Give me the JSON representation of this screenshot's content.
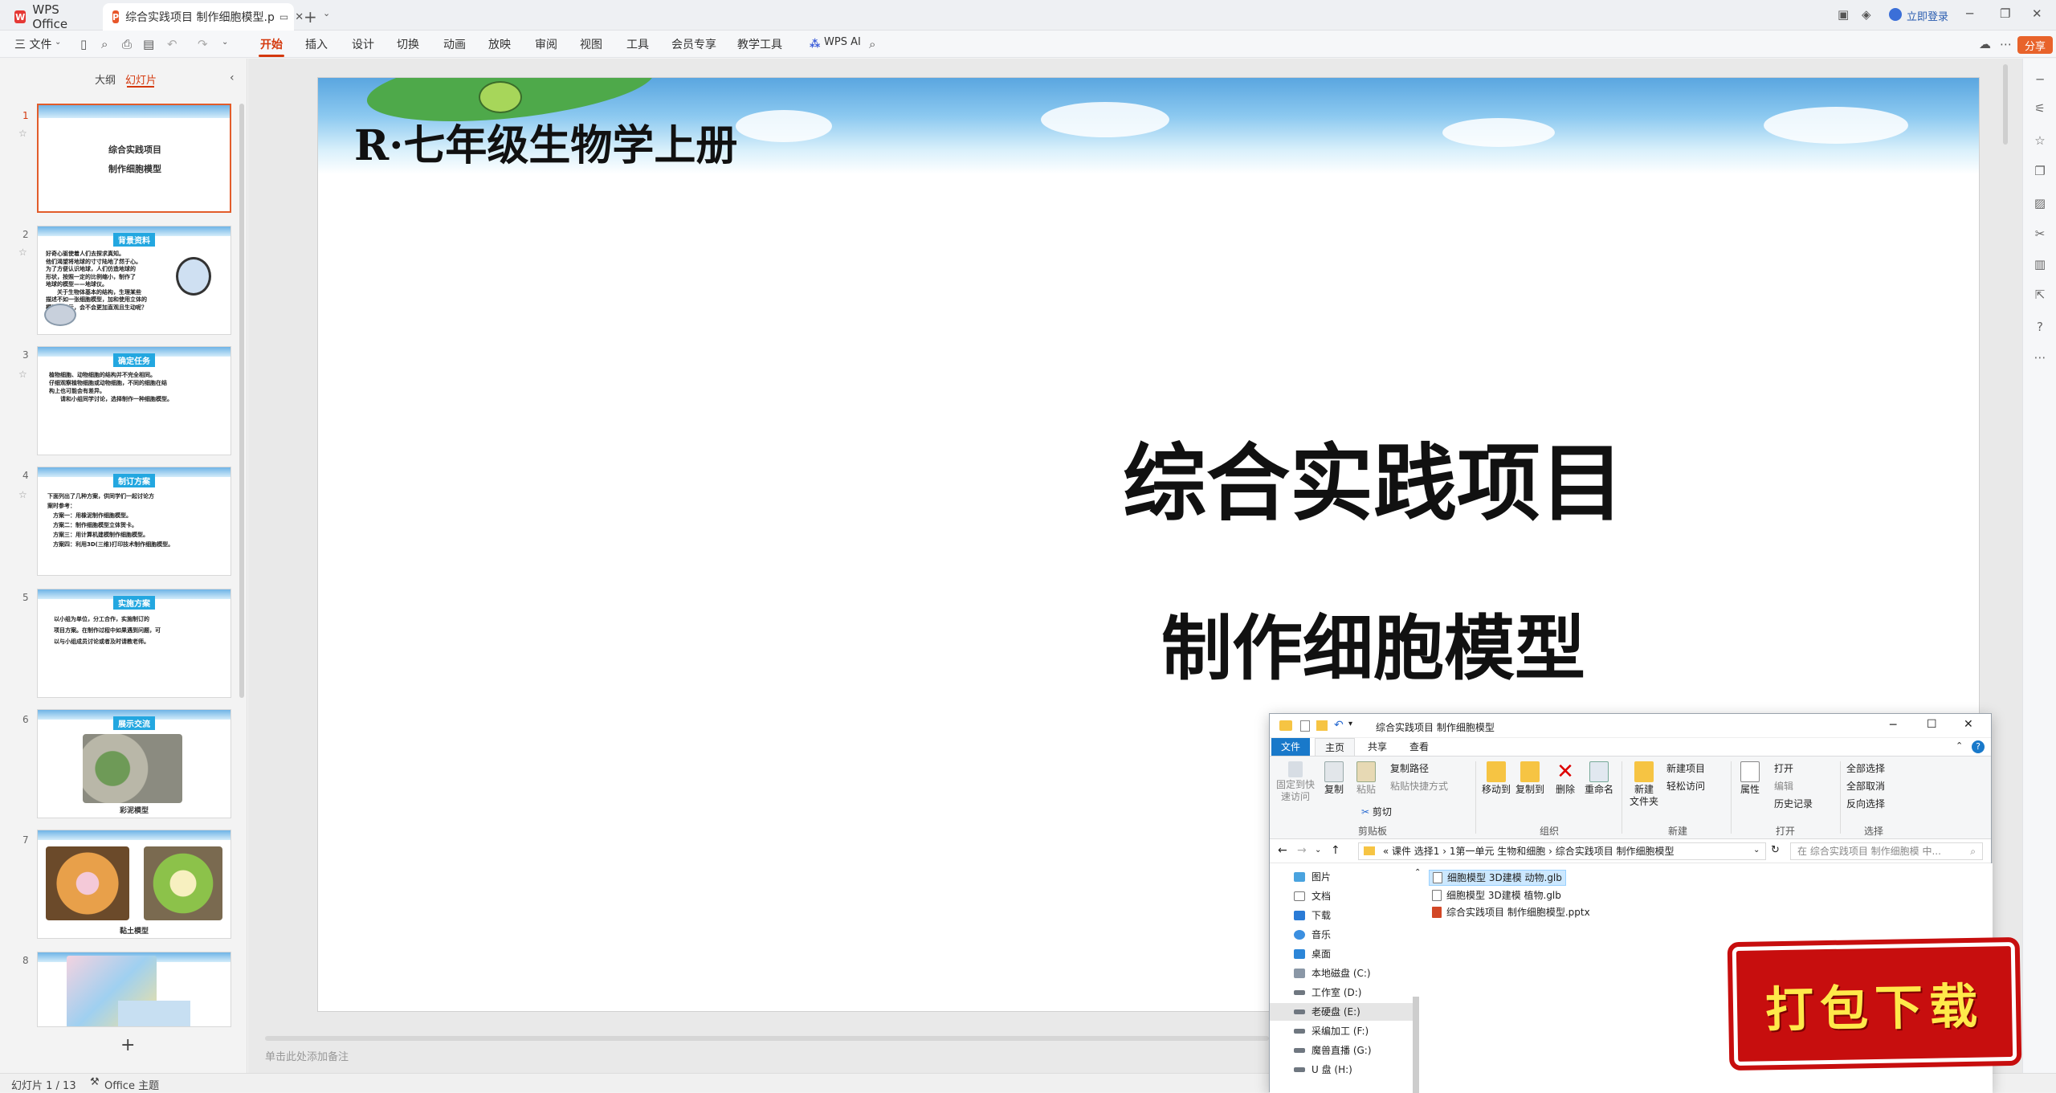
{
  "titlebar": {
    "home_tab": "WPS Office",
    "doc_tab": "综合实践项目 制作细胞模型.p",
    "login": "立即登录"
  },
  "menubar": {
    "file": "三 文件",
    "items": [
      "开始",
      "插入",
      "设计",
      "切换",
      "动画",
      "放映",
      "审阅",
      "视图",
      "工具",
      "会员专享",
      "教学工具"
    ],
    "wps_ai": "WPS AI",
    "share": "分享"
  },
  "sidebar": {
    "tabs": [
      "大纲",
      "幻灯片"
    ],
    "slides": [
      {
        "num": "1",
        "tag": "",
        "text": "综合实践项目\n制作细胞模型"
      },
      {
        "num": "2",
        "tag": "背景资料",
        "text": "好奇心驱使着人们去探求真知。\n他们渴望将地球的寸寸陆地了然于心。\n为了方便认识地球，人们仿造地球的\n形状，按照一定的比例缩小，制作了\n地球的模型——地球仪。\n　　关于生物体基本的结构，生理某些\n描述不如一张细胞模型，加和使用立体的\n模型来展示，会不会更加直观且生动呢？"
      },
      {
        "num": "3",
        "tag": "确定任务",
        "text": "植物细胞、动物细胞的结构并不完全相同。\n仔细观察植物细胞或动物细胞，不同的细胞在结\n构上也可能会有差异。\n　　请和小组同学讨论，选择制作一种细胞模型。"
      },
      {
        "num": "4",
        "tag": "制订方案",
        "text": "下面列出了几种方案，供同学们一起讨论方\n案时参考：\n　方案一：用橡泥制作细胞模型。\n　方案二：制作细胞模型立体贺卡。\n　方案三：用计算机建模制作细胞模型。\n　方案四：利用3D(三维)打印技术制作细胞模型。"
      },
      {
        "num": "5",
        "tag": "实施方案",
        "text": "以小组为单位，分工合作，实施制订的\n项目方案。在制作过程中如果遇到问题，可\n以与小组成员讨论或者及时请教老师。"
      },
      {
        "num": "6",
        "tag": "展示交流",
        "text": "",
        "caption": "彩泥模型"
      },
      {
        "num": "7",
        "tag": "",
        "text": "",
        "caption": "黏土模型"
      },
      {
        "num": "8",
        "tag": "",
        "text": ""
      }
    ],
    "add": "+"
  },
  "slide": {
    "grade_title": "R·七年级生物学上册",
    "main_title": "综合实践项目",
    "sub_title": "制作细胞模型"
  },
  "notes_placeholder": "单击此处添加备注",
  "status": {
    "slide_counter": "幻灯片 1 / 13",
    "theme": "Office 主题"
  },
  "explorer": {
    "title": "综合实践项目 制作细胞模型",
    "tabs": [
      "文件",
      "主页",
      "共享",
      "查看"
    ],
    "ribbon": {
      "pin": "固定到快\n速访问",
      "copy": "复制",
      "paste": "粘贴",
      "copy_path": "复制路径",
      "paste_shortcut": "粘贴快捷方式",
      "cut": "剪切",
      "move_to": "移动到",
      "copy_to": "复制到",
      "delete": "删除",
      "rename": "重命名",
      "new_folder": "新建\n文件夹",
      "new_item": "新建项目",
      "easy_access": "轻松访问",
      "properties": "属性",
      "open": "打开",
      "edit": "编辑",
      "history": "历史记录",
      "select_all": "全部选择",
      "select_none": "全部取消",
      "invert": "反向选择",
      "groups": [
        "剪贴板",
        "组织",
        "新建",
        "打开",
        "选择"
      ]
    },
    "address": "«  课件 选择1  ›  1第一单元 生物和细胞  ›  综合实践项目 制作细胞模型",
    "search_placeholder": "在 综合实践项目 制作细胞模 中...",
    "nav": [
      "图片",
      "文档",
      "下载",
      "音乐",
      "桌面",
      "本地磁盘 (C:)",
      "工作室 (D:)",
      "老硬盘 (E:)",
      "采编加工 (F:)",
      "魔兽直播 (G:)",
      "U 盘 (H:)"
    ],
    "files": [
      "细胞模型 3D建模 动物.glb",
      "细胞模型 3D建模 植物.glb",
      "综合实践项目 制作细胞模型.pptx"
    ]
  },
  "badge": "打包下载"
}
